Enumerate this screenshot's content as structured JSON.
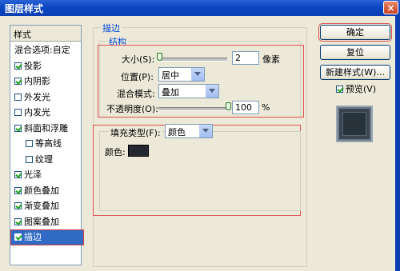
{
  "window": {
    "title": "图层样式",
    "close": "×"
  },
  "styles_panel": {
    "header": "样式",
    "items": [
      {
        "label": "混合选项:自定",
        "checkbox": false,
        "checked": false,
        "indent": false,
        "selected": false
      },
      {
        "label": "投影",
        "checkbox": true,
        "checked": true,
        "indent": false,
        "selected": false
      },
      {
        "label": "内阴影",
        "checkbox": true,
        "checked": true,
        "indent": false,
        "selected": false
      },
      {
        "label": "外发光",
        "checkbox": true,
        "checked": false,
        "indent": false,
        "selected": false
      },
      {
        "label": "内发光",
        "checkbox": true,
        "checked": false,
        "indent": false,
        "selected": false
      },
      {
        "label": "斜面和浮雕",
        "checkbox": true,
        "checked": true,
        "indent": false,
        "selected": false
      },
      {
        "label": "等高线",
        "checkbox": true,
        "checked": false,
        "indent": true,
        "selected": false
      },
      {
        "label": "纹理",
        "checkbox": true,
        "checked": false,
        "indent": true,
        "selected": false
      },
      {
        "label": "光泽",
        "checkbox": true,
        "checked": true,
        "indent": false,
        "selected": false
      },
      {
        "label": "颜色叠加",
        "checkbox": true,
        "checked": true,
        "indent": false,
        "selected": false
      },
      {
        "label": "渐变叠加",
        "checkbox": true,
        "checked": true,
        "indent": false,
        "selected": false
      },
      {
        "label": "图案叠加",
        "checkbox": true,
        "checked": true,
        "indent": false,
        "selected": false
      },
      {
        "label": "描边",
        "checkbox": true,
        "checked": true,
        "indent": false,
        "selected": true
      }
    ]
  },
  "stroke": {
    "section_title": "描边",
    "structure": {
      "title": "结构",
      "size_label": "大小(S):",
      "size_value": "2",
      "size_unit": "像素",
      "size_level": 0.0,
      "position_label": "位置(P):",
      "position_value": "居中",
      "blend_label": "混合模式:",
      "blend_value": "叠加",
      "opacity_label": "不透明度(O):",
      "opacity_value": "100",
      "opacity_unit": "%",
      "opacity_level": 1.0
    },
    "fill": {
      "type_label": "填充类型(F):",
      "type_value": "颜色",
      "color_label": "颜色:",
      "color": "#242830"
    }
  },
  "buttons": {
    "ok": "确定",
    "reset": "复位",
    "new_style": "新建样式(W)...",
    "preview_label": "预览(V)",
    "preview_checked": true
  },
  "colors": {
    "titlebar": "#0b46c2",
    "selection": "#316ac5",
    "highlight_box": "#e05050"
  }
}
